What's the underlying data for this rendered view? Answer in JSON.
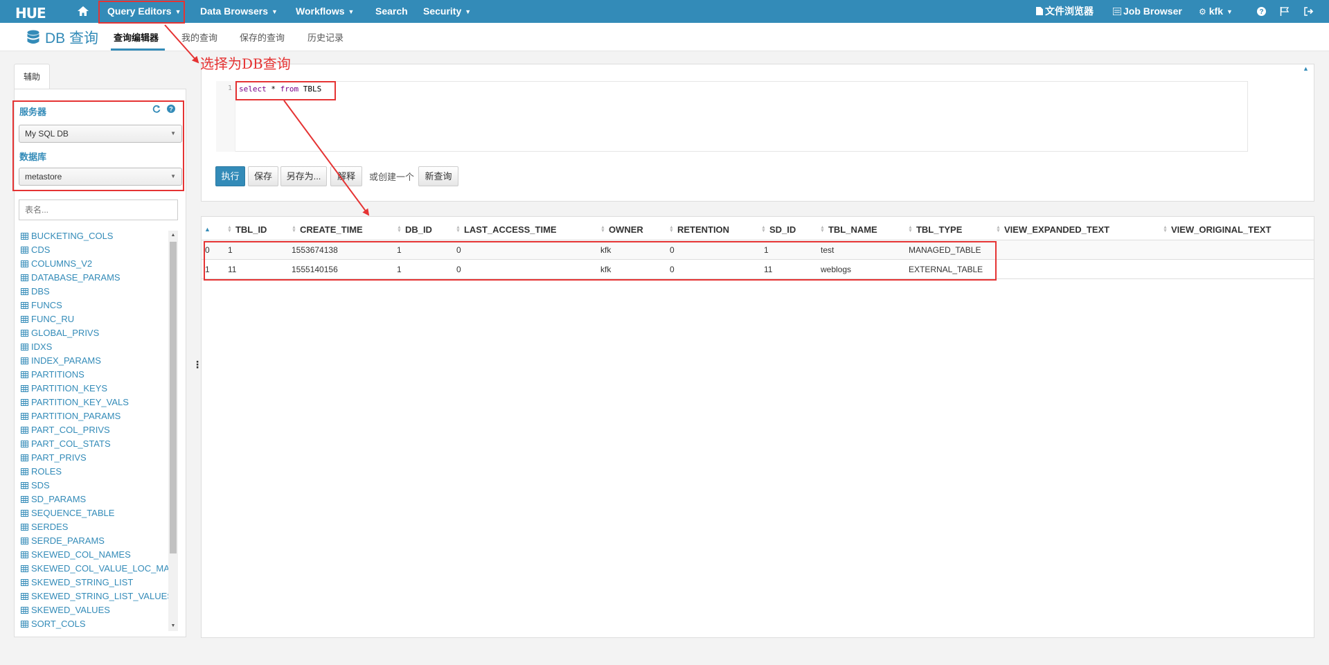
{
  "navbar": {
    "logo": "HUE",
    "menus": [
      "Query Editors",
      "Data Browsers",
      "Workflows",
      "Search",
      "Security"
    ],
    "right": {
      "file_browser": "文件浏览器",
      "job_browser": "Job Browser",
      "user": "kfk"
    }
  },
  "subheader": {
    "app_title": "DB 查询",
    "tabs": [
      "查询编辑器",
      "我的查询",
      "保存的查询",
      "历史记录"
    ]
  },
  "assist": {
    "tab_label": "辅助",
    "server_label": "服务器",
    "server_value": "My SQL DB",
    "database_label": "数据库",
    "database_value": "metastore",
    "filter_placeholder": "表名...",
    "tables": [
      "BUCKETING_COLS",
      "CDS",
      "COLUMNS_V2",
      "DATABASE_PARAMS",
      "DBS",
      "FUNCS",
      "FUNC_RU",
      "GLOBAL_PRIVS",
      "IDXS",
      "INDEX_PARAMS",
      "PARTITIONS",
      "PARTITION_KEYS",
      "PARTITION_KEY_VALS",
      "PARTITION_PARAMS",
      "PART_COL_PRIVS",
      "PART_COL_STATS",
      "PART_PRIVS",
      "ROLES",
      "SDS",
      "SD_PARAMS",
      "SEQUENCE_TABLE",
      "SERDES",
      "SERDE_PARAMS",
      "SKEWED_COL_NAMES",
      "SKEWED_COL_VALUE_LOC_MAP",
      "SKEWED_STRING_LIST",
      "SKEWED_STRING_LIST_VALUES",
      "SKEWED_VALUES",
      "SORT_COLS"
    ]
  },
  "editor": {
    "line_number": "1",
    "query_kw1": "select",
    "query_mid": " * ",
    "query_kw2": "from",
    "query_rest": " TBLS",
    "buttons": {
      "execute": "执行",
      "save": "保存",
      "save_as": "另存为...",
      "explain": "解释",
      "or_create": "或创建一个",
      "new_query": "新查询"
    }
  },
  "annotation": {
    "text": "选择为DB查询"
  },
  "results": {
    "columns": [
      "TBL_ID",
      "CREATE_TIME",
      "DB_ID",
      "LAST_ACCESS_TIME",
      "OWNER",
      "RETENTION",
      "SD_ID",
      "TBL_NAME",
      "TBL_TYPE",
      "VIEW_EXPANDED_TEXT",
      "VIEW_ORIGINAL_TEXT"
    ],
    "rows": [
      {
        "index": "0",
        "cells": [
          "1",
          "1553674138",
          "1",
          "0",
          "kfk",
          "0",
          "1",
          "test",
          "MANAGED_TABLE",
          "",
          ""
        ]
      },
      {
        "index": "1",
        "cells": [
          "11",
          "1555140156",
          "1",
          "0",
          "kfk",
          "0",
          "11",
          "weblogs",
          "EXTERNAL_TABLE",
          "",
          ""
        ]
      }
    ]
  },
  "colors": {
    "brand": "#338bb8",
    "annotation": "#e53333"
  }
}
